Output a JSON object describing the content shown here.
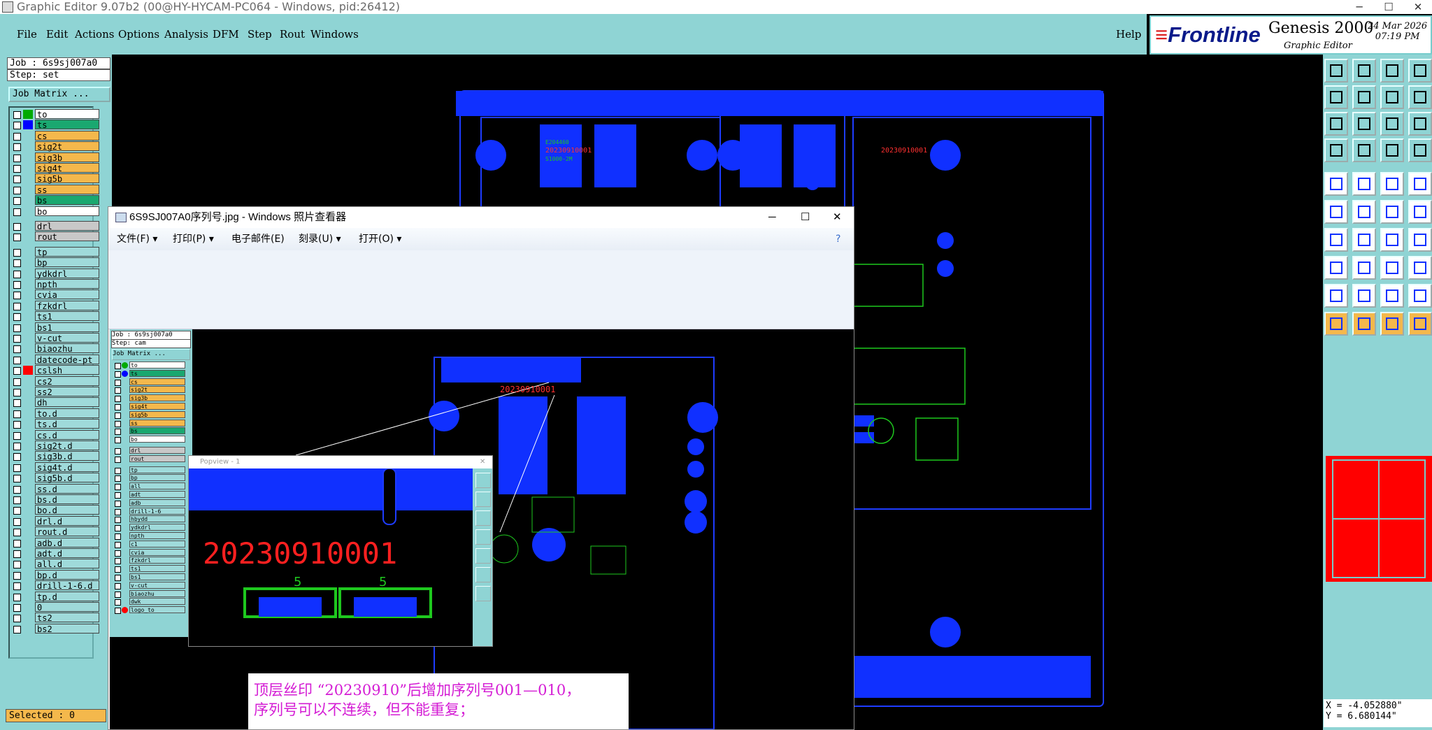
{
  "window": {
    "title": "Graphic Editor 9.07b2 (00@HY-HYCAM-PC064 - Windows, pid:26412)"
  },
  "menu": [
    "File",
    "Edit",
    "Actions",
    "Options",
    "Analysis",
    "DFM",
    "Step",
    "Rout",
    "Windows"
  ],
  "help_label": "Help",
  "brand": {
    "logo": "Frontline",
    "product": "Genesis 2000",
    "subtitle": "Graphic Editor",
    "date": "24 Mar 2026",
    "time": "07:19 PM"
  },
  "left": {
    "job": "Job : 6s9sj007a0",
    "step": "Step: set",
    "matrix_button": "Job Matrix ...",
    "selected": "Selected : 0",
    "layers": [
      {
        "name": "to",
        "color": "#ffffff",
        "sw": "#00aa00"
      },
      {
        "name": "ts",
        "color": "#1aa870",
        "sw": "#0000ff"
      },
      {
        "name": "cs",
        "color": "#f4b84c",
        "sw": ""
      },
      {
        "name": "sig2t",
        "color": "#f4b84c",
        "sw": ""
      },
      {
        "name": "sig3b",
        "color": "#f4b84c",
        "sw": ""
      },
      {
        "name": "sig4t",
        "color": "#f4b84c",
        "sw": ""
      },
      {
        "name": "sig5b",
        "color": "#f4b84c",
        "sw": ""
      },
      {
        "name": "ss",
        "color": "#f4b84c",
        "sw": ""
      },
      {
        "name": "bs",
        "color": "#1aa870",
        "sw": ""
      },
      {
        "name": "bo",
        "color": "#ffffff",
        "sw": ""
      },
      {
        "name": "drl",
        "color": "#c8c8c8",
        "sw": ""
      },
      {
        "name": "rout",
        "color": "#c8c8c8",
        "sw": ""
      },
      {
        "name": "tp",
        "color": "#9fdada",
        "sw": ""
      },
      {
        "name": "bp",
        "color": "#9fdada",
        "sw": ""
      },
      {
        "name": "ydkdrl",
        "color": "#9fdada",
        "sw": ""
      },
      {
        "name": "npth",
        "color": "#9fdada",
        "sw": ""
      },
      {
        "name": "cvia",
        "color": "#9fdada",
        "sw": ""
      },
      {
        "name": "fzkdrl",
        "color": "#9fdada",
        "sw": ""
      },
      {
        "name": "ts1",
        "color": "#9fdada",
        "sw": ""
      },
      {
        "name": "bs1",
        "color": "#9fdada",
        "sw": ""
      },
      {
        "name": "v-cut",
        "color": "#9fdada",
        "sw": ""
      },
      {
        "name": "biaozhu",
        "color": "#9fdada",
        "sw": ""
      },
      {
        "name": "datecode-pt",
        "color": "#9fdada",
        "sw": ""
      },
      {
        "name": "cslsh",
        "color": "#9fdada",
        "sw": "#ff0000"
      },
      {
        "name": "cs2",
        "color": "#9fdada",
        "sw": ""
      },
      {
        "name": "ss2",
        "color": "#9fdada",
        "sw": ""
      },
      {
        "name": "dh",
        "color": "#9fdada",
        "sw": ""
      },
      {
        "name": "to.d",
        "color": "#9fdada",
        "sw": ""
      },
      {
        "name": "ts.d",
        "color": "#9fdada",
        "sw": ""
      },
      {
        "name": "cs.d",
        "color": "#9fdada",
        "sw": ""
      },
      {
        "name": "sig2t.d",
        "color": "#9fdada",
        "sw": ""
      },
      {
        "name": "sig3b.d",
        "color": "#9fdada",
        "sw": ""
      },
      {
        "name": "sig4t.d",
        "color": "#9fdada",
        "sw": ""
      },
      {
        "name": "sig5b.d",
        "color": "#9fdada",
        "sw": ""
      },
      {
        "name": "ss.d",
        "color": "#9fdada",
        "sw": ""
      },
      {
        "name": "bs.d",
        "color": "#9fdada",
        "sw": ""
      },
      {
        "name": "bo.d",
        "color": "#9fdada",
        "sw": ""
      },
      {
        "name": "drl.d",
        "color": "#9fdada",
        "sw": ""
      },
      {
        "name": "rout.d",
        "color": "#9fdada",
        "sw": ""
      },
      {
        "name": "adb.d",
        "color": "#9fdada",
        "sw": ""
      },
      {
        "name": "adt.d",
        "color": "#9fdada",
        "sw": ""
      },
      {
        "name": "all.d",
        "color": "#9fdada",
        "sw": ""
      },
      {
        "name": "bp.d",
        "color": "#9fdada",
        "sw": ""
      },
      {
        "name": "drill-1-6.d",
        "color": "#9fdada",
        "sw": ""
      },
      {
        "name": "tp.d",
        "color": "#9fdada",
        "sw": ""
      },
      {
        "name": "0",
        "color": "#9fdada",
        "sw": ""
      },
      {
        "name": "ts2",
        "color": "#9fdada",
        "sw": ""
      },
      {
        "name": "bs2",
        "color": "#9fdada",
        "sw": ""
      }
    ]
  },
  "board_text": {
    "date_code": "20230910001",
    "mark_a": "E204460",
    "mark_b": "S1000-2M"
  },
  "coords": {
    "x": "X = -4.052880\"",
    "y": "Y = 6.680144\""
  },
  "viewer": {
    "title": "6S9SJ007A0序列号.jpg - Windows 照片查看器",
    "menu": [
      "文件(F)",
      "打印(P)",
      "电子邮件(E)",
      "刻录(U)",
      "打开(O)"
    ],
    "mini": {
      "job": "Job : 6s9sj007a0",
      "step": "Step: cam",
      "matrix_button": "Job Matrix ...",
      "layers": [
        {
          "name": "to",
          "color": "#ffffff",
          "sw": "#00aa00"
        },
        {
          "name": "ts",
          "color": "#1aa870",
          "sw": "#0000ff"
        },
        {
          "name": "cs",
          "color": "#f4b84c",
          "sw": ""
        },
        {
          "name": "sig2t",
          "color": "#f4b84c",
          "sw": ""
        },
        {
          "name": "sig3b",
          "color": "#f4b84c",
          "sw": ""
        },
        {
          "name": "sig4t",
          "color": "#f4b84c",
          "sw": ""
        },
        {
          "name": "sig5b",
          "color": "#f4b84c",
          "sw": ""
        },
        {
          "name": "ss",
          "color": "#f4b84c",
          "sw": ""
        },
        {
          "name": "bs",
          "color": "#1aa870",
          "sw": ""
        },
        {
          "name": "bo",
          "color": "#ffffff",
          "sw": ""
        },
        {
          "name": "drl",
          "color": "#c8c8c8",
          "sw": ""
        },
        {
          "name": "rout",
          "color": "#c8c8c8",
          "sw": ""
        },
        {
          "name": "tp",
          "color": "#9fdada",
          "sw": ""
        },
        {
          "name": "bp",
          "color": "#9fdada",
          "sw": ""
        },
        {
          "name": "all",
          "color": "#9fdada",
          "sw": ""
        },
        {
          "name": "adt",
          "color": "#9fdada",
          "sw": ""
        },
        {
          "name": "adb",
          "color": "#9fdada",
          "sw": ""
        },
        {
          "name": "drill-1-6",
          "color": "#9fdada",
          "sw": ""
        },
        {
          "name": "hbydd",
          "color": "#9fdada",
          "sw": ""
        },
        {
          "name": "ydkdrl",
          "color": "#9fdada",
          "sw": ""
        },
        {
          "name": "npth",
          "color": "#9fdada",
          "sw": ""
        },
        {
          "name": "c1",
          "color": "#9fdada",
          "sw": ""
        },
        {
          "name": "cvia",
          "color": "#9fdada",
          "sw": ""
        },
        {
          "name": "fzkdrl",
          "color": "#9fdada",
          "sw": ""
        },
        {
          "name": "ts1",
          "color": "#9fdada",
          "sw": ""
        },
        {
          "name": "bs1",
          "color": "#9fdada",
          "sw": ""
        },
        {
          "name": "v-cut",
          "color": "#9fdada",
          "sw": ""
        },
        {
          "name": "biaozhu",
          "color": "#9fdada",
          "sw": ""
        },
        {
          "name": "dwk",
          "color": "#9fdada",
          "sw": ""
        },
        {
          "name": "logo_to",
          "color": "#9fdada",
          "sw": "#ff0000"
        }
      ]
    },
    "popview_title": "Popview - 1",
    "popview_number": "20230910001",
    "popview_marks": [
      "5",
      "5"
    ],
    "note_line1": "顶层丝印 “20230910”后增加序列号001—010，",
    "note_line2": "序列号可以不连续，但不能重复；"
  }
}
